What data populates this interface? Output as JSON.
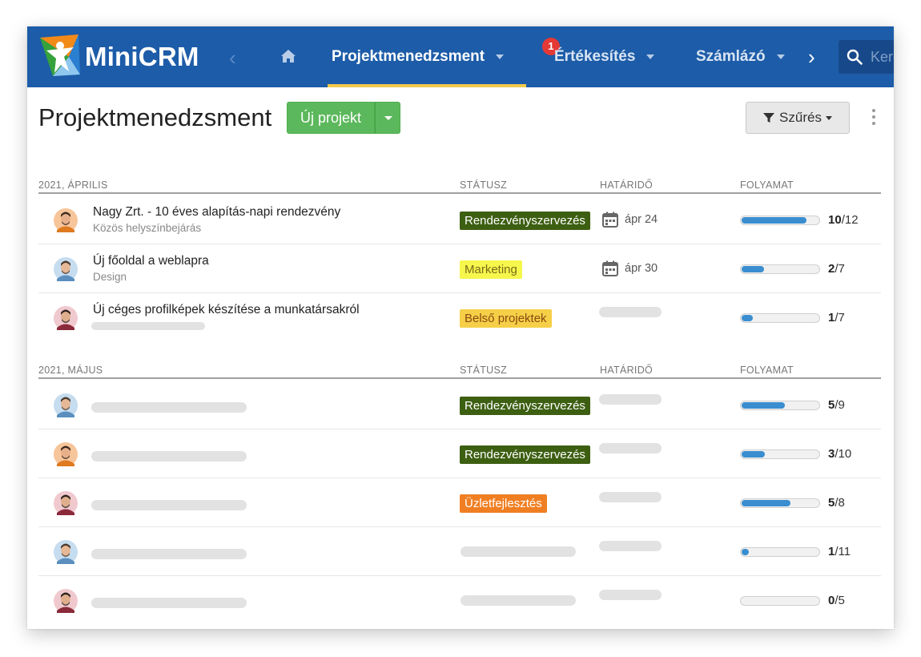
{
  "nav": {
    "brand": "MiniCRM",
    "items": [
      {
        "label": "Projektmenedzsment",
        "active": true
      },
      {
        "label": "Értékesítés",
        "badge": "1"
      },
      {
        "label": "Számlázó"
      }
    ],
    "search_placeholder": "Kereső",
    "colors": {
      "bar": "#1d5ca8",
      "active_underline": "#f2c94c",
      "badge": "#e53935"
    }
  },
  "page": {
    "title": "Projektmenedzsment",
    "new_button": "Új projekt",
    "filter_button": "Szűrés"
  },
  "columns": {
    "status": "STÁTUSZ",
    "deadline": "HATÁRIDŐ",
    "progress": "FOLYAMAT"
  },
  "sections": [
    {
      "heading": "2021, ÁPRILIS",
      "rows": [
        {
          "avatar": "avatar-orange",
          "name": "Nagy Zrt. - 10 éves alapítás-napi rendezvény",
          "sub": "Közös helyszínbejárás",
          "status": "Rendezvényszervezés",
          "status_bg": "#3d5f12",
          "status_fg": "#ffffff",
          "deadline": "ápr 24",
          "done": "10",
          "total": "/12",
          "progress": 0.8333
        },
        {
          "avatar": "avatar-blue",
          "name": "Új főoldal a weblapra",
          "sub": "Design",
          "status": "Marketing",
          "status_bg": "#f6f74c",
          "status_fg": "#7a6a1a",
          "deadline": "ápr 30",
          "done": "2",
          "total": "/7",
          "progress": 0.2857
        },
        {
          "avatar": "avatar-red",
          "name": "Új céges profilképek készítése a munkatársakról",
          "sub": "",
          "status": "Belső projektek",
          "status_bg": "#f5cf47",
          "status_fg": "#8a4a12",
          "deadline": "",
          "done": "1",
          "total": "/7",
          "progress": 0.1429
        }
      ]
    },
    {
      "heading": "2021, MÁJUS",
      "rows": [
        {
          "avatar": "avatar-blue",
          "name": "",
          "sub": "",
          "status": "Rendezvényszervezés",
          "status_bg": "#3d5f12",
          "status_fg": "#ffffff",
          "deadline": "",
          "done": "5",
          "total": "/9",
          "progress": 0.5556
        },
        {
          "avatar": "avatar-orange",
          "name": "",
          "sub": "",
          "status": "Rendezvényszervezés",
          "status_bg": "#3d5f12",
          "status_fg": "#ffffff",
          "deadline": "",
          "done": "3",
          "total": "/10",
          "progress": 0.3
        },
        {
          "avatar": "avatar-red",
          "name": "",
          "sub": "",
          "status": "Üzletfejlesztés",
          "status_bg": "#f07f23",
          "status_fg": "#ffffff",
          "deadline": "",
          "done": "5",
          "total": "/8",
          "progress": 0.625
        },
        {
          "avatar": "avatar-blue",
          "name": "",
          "sub": "",
          "status": "",
          "status_bg": "",
          "status_fg": "",
          "deadline": "",
          "done": "1",
          "total": "/11",
          "progress": 0.0909
        },
        {
          "avatar": "avatar-red",
          "name": "",
          "sub": "",
          "status": "",
          "status_bg": "",
          "status_fg": "",
          "deadline": "",
          "done": "0",
          "total": "/5",
          "progress": 0
        }
      ]
    }
  ]
}
